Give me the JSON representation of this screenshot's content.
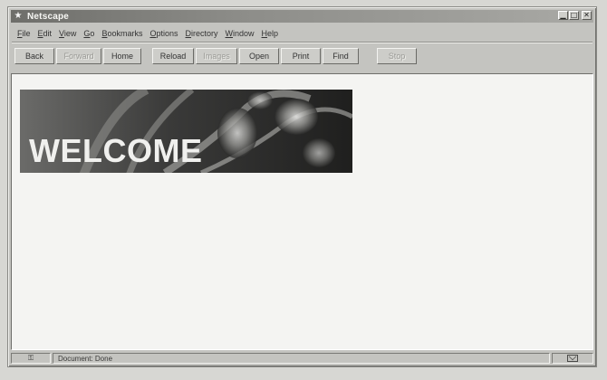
{
  "window": {
    "title": "Netscape",
    "controls": [
      "minimize",
      "maximize",
      "close"
    ]
  },
  "menu": [
    {
      "label": "File",
      "mnemonic": "F",
      "rest": "ile"
    },
    {
      "label": "Edit",
      "mnemonic": "E",
      "rest": "dit"
    },
    {
      "label": "View",
      "mnemonic": "V",
      "rest": "iew"
    },
    {
      "label": "Go",
      "mnemonic": "G",
      "rest": "o"
    },
    {
      "label": "Bookmarks",
      "mnemonic": "B",
      "rest": "ookmarks"
    },
    {
      "label": "Options",
      "mnemonic": "O",
      "rest": "ptions"
    },
    {
      "label": "Directory",
      "mnemonic": "D",
      "rest": "irectory"
    },
    {
      "label": "Window",
      "mnemonic": "W",
      "rest": "indow"
    },
    {
      "label": "Help",
      "mnemonic": "H",
      "rest": "elp"
    }
  ],
  "toolbar": {
    "back": "Back",
    "forward": "Forward",
    "home": "Home",
    "reload": "Reload",
    "images": "Images",
    "open": "Open",
    "print": "Print",
    "find": "Find",
    "stop": "Stop"
  },
  "content": {
    "banner_text": "WELCOME"
  },
  "status": {
    "security_icon": "broken-key-icon",
    "text": "Document: Done",
    "mail_icon": "mail-icon"
  }
}
